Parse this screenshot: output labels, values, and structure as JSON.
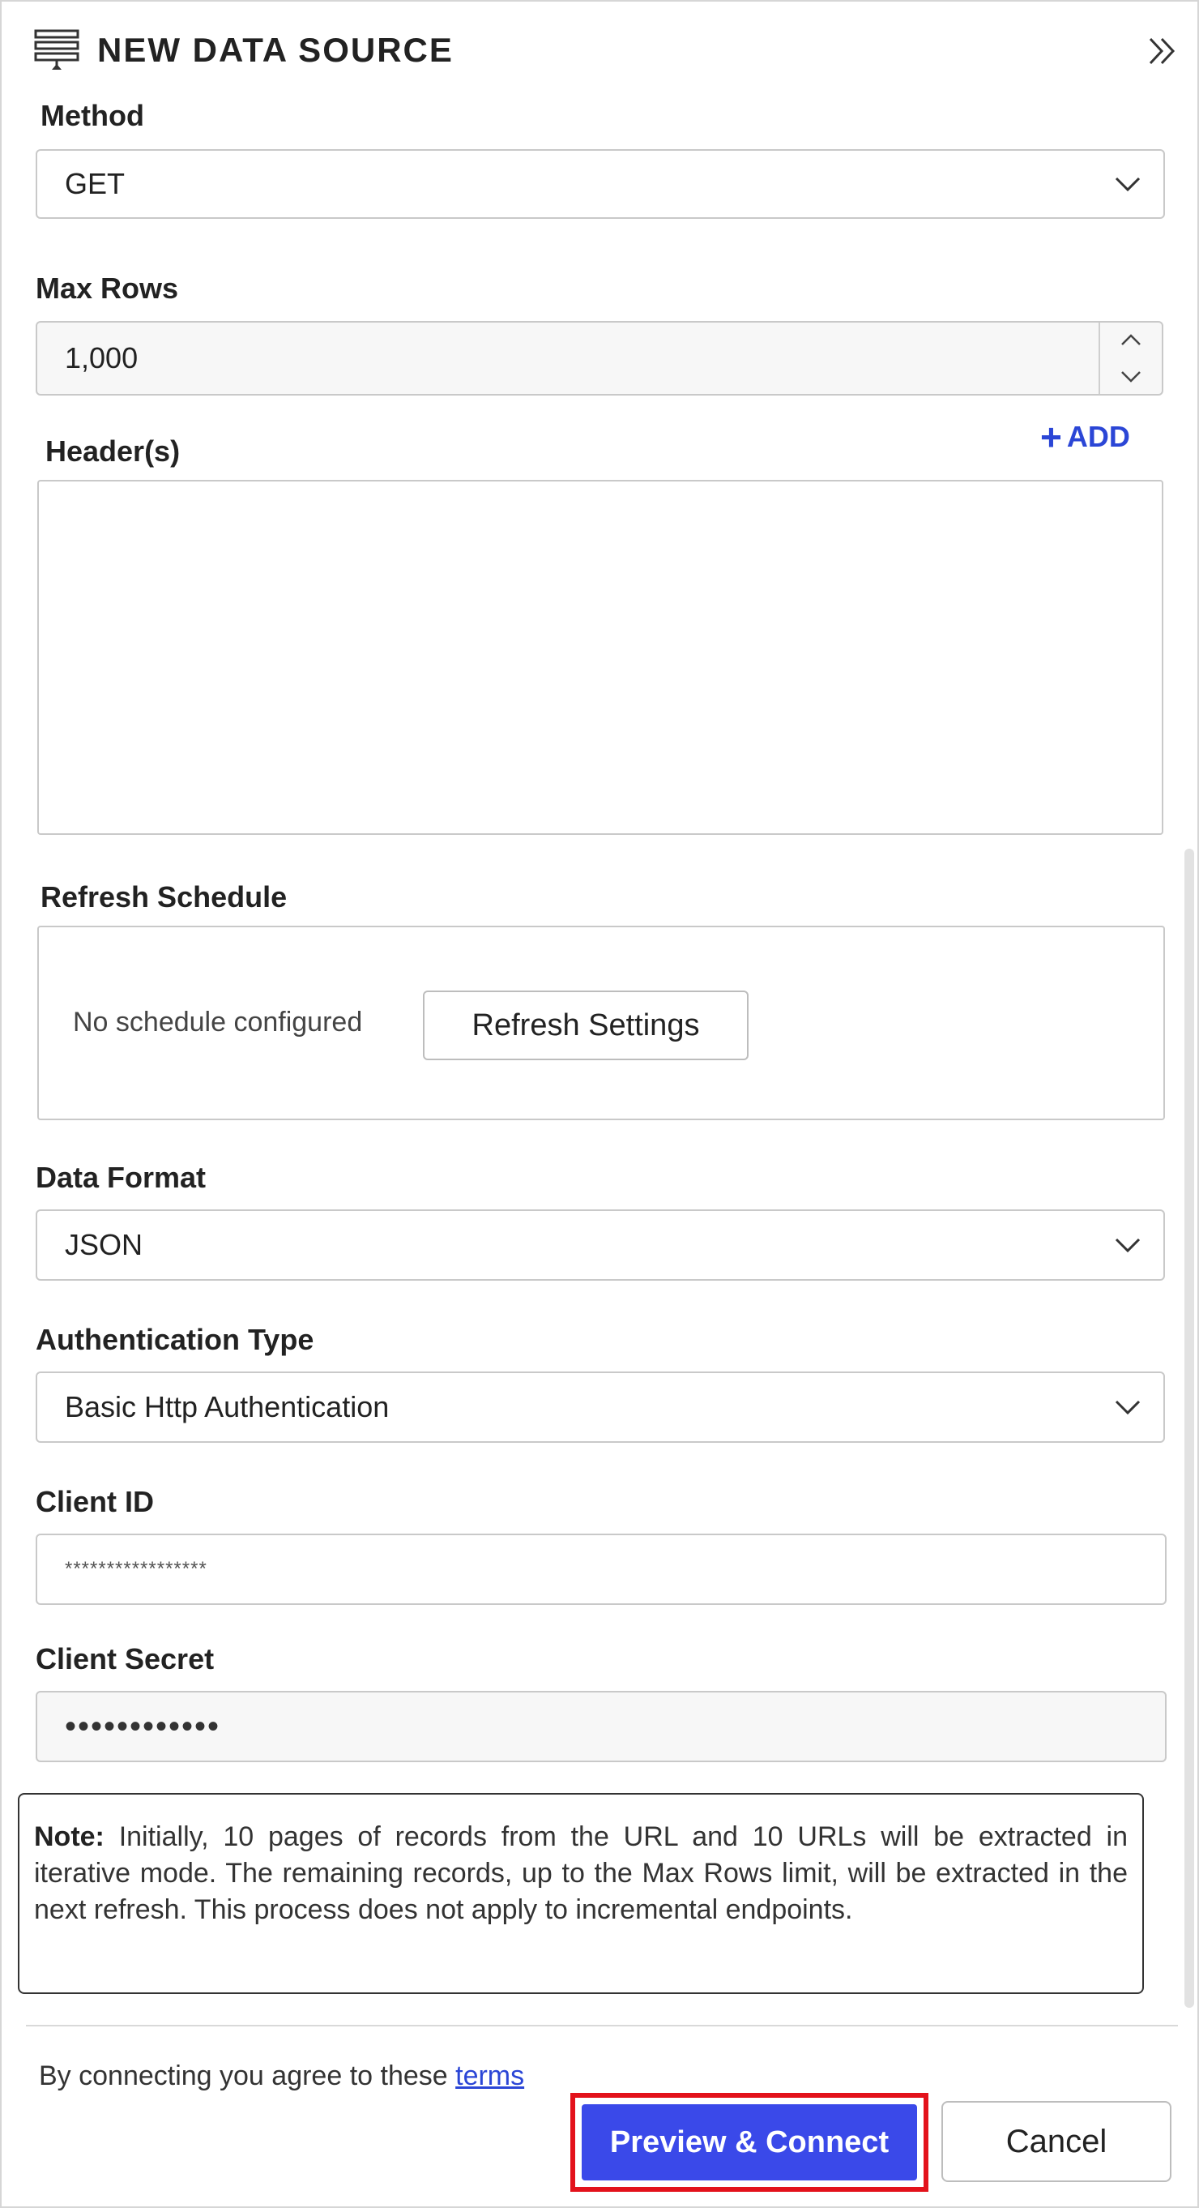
{
  "header": {
    "title": "NEW DATA SOURCE",
    "icon": "data-source-icon",
    "collapse_icon": "double-chevron-right-icon"
  },
  "method": {
    "label": "Method",
    "value": "GET"
  },
  "max_rows": {
    "label": "Max Rows",
    "value": "1,000"
  },
  "headers": {
    "label": "Header(s)",
    "add_label": "ADD",
    "add_symbol": "+"
  },
  "refresh_schedule": {
    "label": "Refresh Schedule",
    "status": "No schedule configured",
    "button_label": "Refresh Settings"
  },
  "data_format": {
    "label": "Data Format",
    "value": "JSON"
  },
  "auth_type": {
    "label": "Authentication Type",
    "value": "Basic Http Authentication"
  },
  "client_id": {
    "label": "Client ID",
    "value": "*****************"
  },
  "client_secret": {
    "label": "Client Secret",
    "value": "••••••••••••"
  },
  "note": {
    "prefix": "Note:",
    "text": " Initially, 10 pages of records from the URL and 10 URLs will be extracted in iterative mode. The remaining records, up to the Max Rows limit, will be extracted in the next refresh. This process does not apply to incremental endpoints."
  },
  "footer": {
    "agree_text": "By connecting you agree to these ",
    "terms_link": "terms",
    "preview_button": "Preview & Connect",
    "cancel_button": "Cancel"
  },
  "colors": {
    "accent": "#3a49e9",
    "highlight": "#e3121b",
    "link": "#2b46d6"
  }
}
